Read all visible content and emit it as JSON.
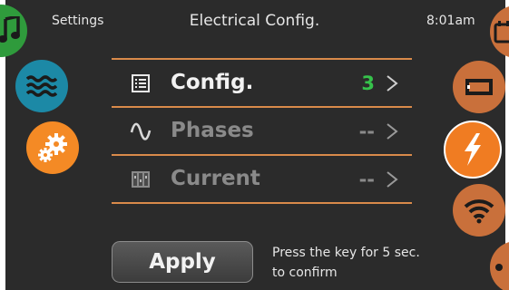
{
  "header": {
    "left_label": "Settings",
    "title": "Electrical Config.",
    "time": "8:01am"
  },
  "left_nav": [
    {
      "icon": "music-note-icon",
      "color": "#2f9b3c"
    },
    {
      "icon": "water-waves-icon",
      "color": "#1c89a6"
    },
    {
      "icon": "gears-icon",
      "color": "#f48a25"
    }
  ],
  "right_nav": [
    {
      "icon": "calendar-icon",
      "color": "#c9703b"
    },
    {
      "icon": "display-panel-icon",
      "color": "#c9703b"
    },
    {
      "icon": "lightning-icon",
      "color": "#f07c22",
      "selected": true
    },
    {
      "icon": "wifi-icon",
      "color": "#c9703b"
    },
    {
      "icon": "dots-icon",
      "color": "#c9703b"
    }
  ],
  "rows": [
    {
      "label": "Config.",
      "value": "3",
      "icon": "list-icon",
      "enabled": true
    },
    {
      "label": "Phases",
      "value": "--",
      "icon": "sine-wave-icon",
      "enabled": false
    },
    {
      "label": "Current",
      "value": "--",
      "icon": "breaker-icon",
      "enabled": false
    }
  ],
  "apply": {
    "label": "Apply",
    "hint_line1": "Press the key for 5 sec.",
    "hint_line2": "to confirm"
  },
  "colors": {
    "background": "#2b2b2b",
    "accent_orange": "#f07c22",
    "separator": "#d98a4a",
    "value_green": "#36c24b"
  }
}
